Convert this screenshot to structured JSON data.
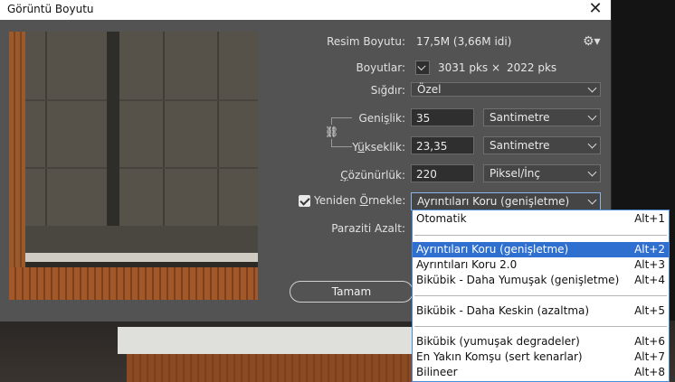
{
  "dialog": {
    "title": "Görüntü Boyutu",
    "close_glyph": "✕"
  },
  "image_size": {
    "label": "Resim Boyutu:",
    "value": "17,5M (3,66M idi)"
  },
  "dimensions": {
    "label": "Boyutlar:",
    "width": "3031 pks",
    "times": "×",
    "height": "2022 pks"
  },
  "fit": {
    "label": "Sığdır:",
    "selected": "Özel"
  },
  "width": {
    "label_pre": "Geni",
    "label_ul": "ş",
    "label_post": "lik:",
    "value": "35",
    "unit": "Santimetre"
  },
  "height": {
    "label_pre": "Y",
    "label_ul": "ü",
    "label_post": "kseklik:",
    "value": "23,35",
    "unit": "Santimetre"
  },
  "resolution": {
    "label_ul": "Ç",
    "label_post": "özünürlük:",
    "value": "220",
    "unit": "Piksel/İnç"
  },
  "resample": {
    "checked": true,
    "label_pre": "Yeniden ",
    "label_ul": "Ö",
    "label_post": "rnekle:",
    "selected": "Ayrıntıları Koru (genişletme)"
  },
  "noise": {
    "label": "Paraziti Azalt:"
  },
  "ok_button": "Tamam",
  "icons": {
    "gear": "gear-icon",
    "link": "chain-link-icon",
    "chevron": "chevron-down-icon"
  },
  "menu": {
    "items": [
      {
        "label": "Otomatik",
        "shortcut": "Alt+1"
      },
      {
        "label": "Ayrıntıları Koru (genişletme)",
        "shortcut": "Alt+2",
        "selected": true
      },
      {
        "label": "Ayrıntıları Koru 2.0",
        "shortcut": "Alt+3"
      },
      {
        "label": "Bikübik - Daha Yumuşak (genişletme)",
        "shortcut": "Alt+4"
      },
      {
        "label": "Bikübik - Daha Keskin (azaltma)",
        "shortcut": "Alt+5"
      },
      {
        "label": "Bikübik (yumuşak degradeler)",
        "shortcut": "Alt+6"
      },
      {
        "label": "En Yakın Komşu (sert kenarlar)",
        "shortcut": "Alt+7"
      },
      {
        "label": "Bilineer",
        "shortcut": "Alt+8"
      }
    ]
  },
  "colors": {
    "menu_highlight": "#2f6fd0",
    "dialog_bg": "#535353",
    "menu_border": "#4b8ad8"
  }
}
